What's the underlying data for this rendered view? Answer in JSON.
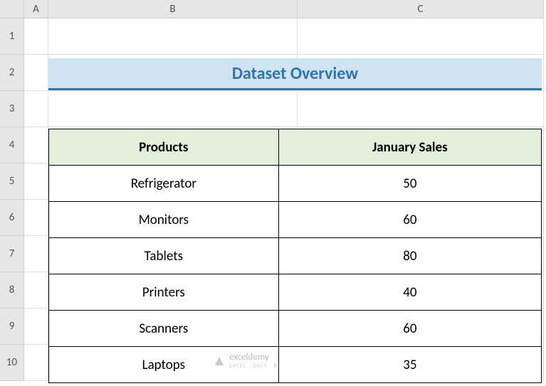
{
  "columns": {
    "A": "A",
    "B": "B",
    "C": "C"
  },
  "row_labels": [
    "1",
    "2",
    "3",
    "4",
    "5",
    "6",
    "7",
    "8",
    "9",
    "10"
  ],
  "title": "Dataset Overview",
  "table": {
    "headers": {
      "products": "Products",
      "january_sales": "January Sales"
    },
    "rows": [
      {
        "product": "Refrigerator",
        "sales": "50"
      },
      {
        "product": "Monitors",
        "sales": "60"
      },
      {
        "product": "Tablets",
        "sales": "80"
      },
      {
        "product": "Printers",
        "sales": "40"
      },
      {
        "product": "Scanners",
        "sales": "60"
      },
      {
        "product": "Laptops",
        "sales": "35"
      }
    ]
  },
  "watermark": {
    "brand": "exceldemy",
    "tagline": "EXCEL · DATA · BI"
  },
  "chart_data": {
    "type": "table",
    "title": "Dataset Overview",
    "categories": [
      "Refrigerator",
      "Monitors",
      "Tablets",
      "Printers",
      "Scanners",
      "Laptops"
    ],
    "series": [
      {
        "name": "January Sales",
        "values": [
          50,
          60,
          80,
          40,
          60,
          35
        ]
      }
    ]
  }
}
